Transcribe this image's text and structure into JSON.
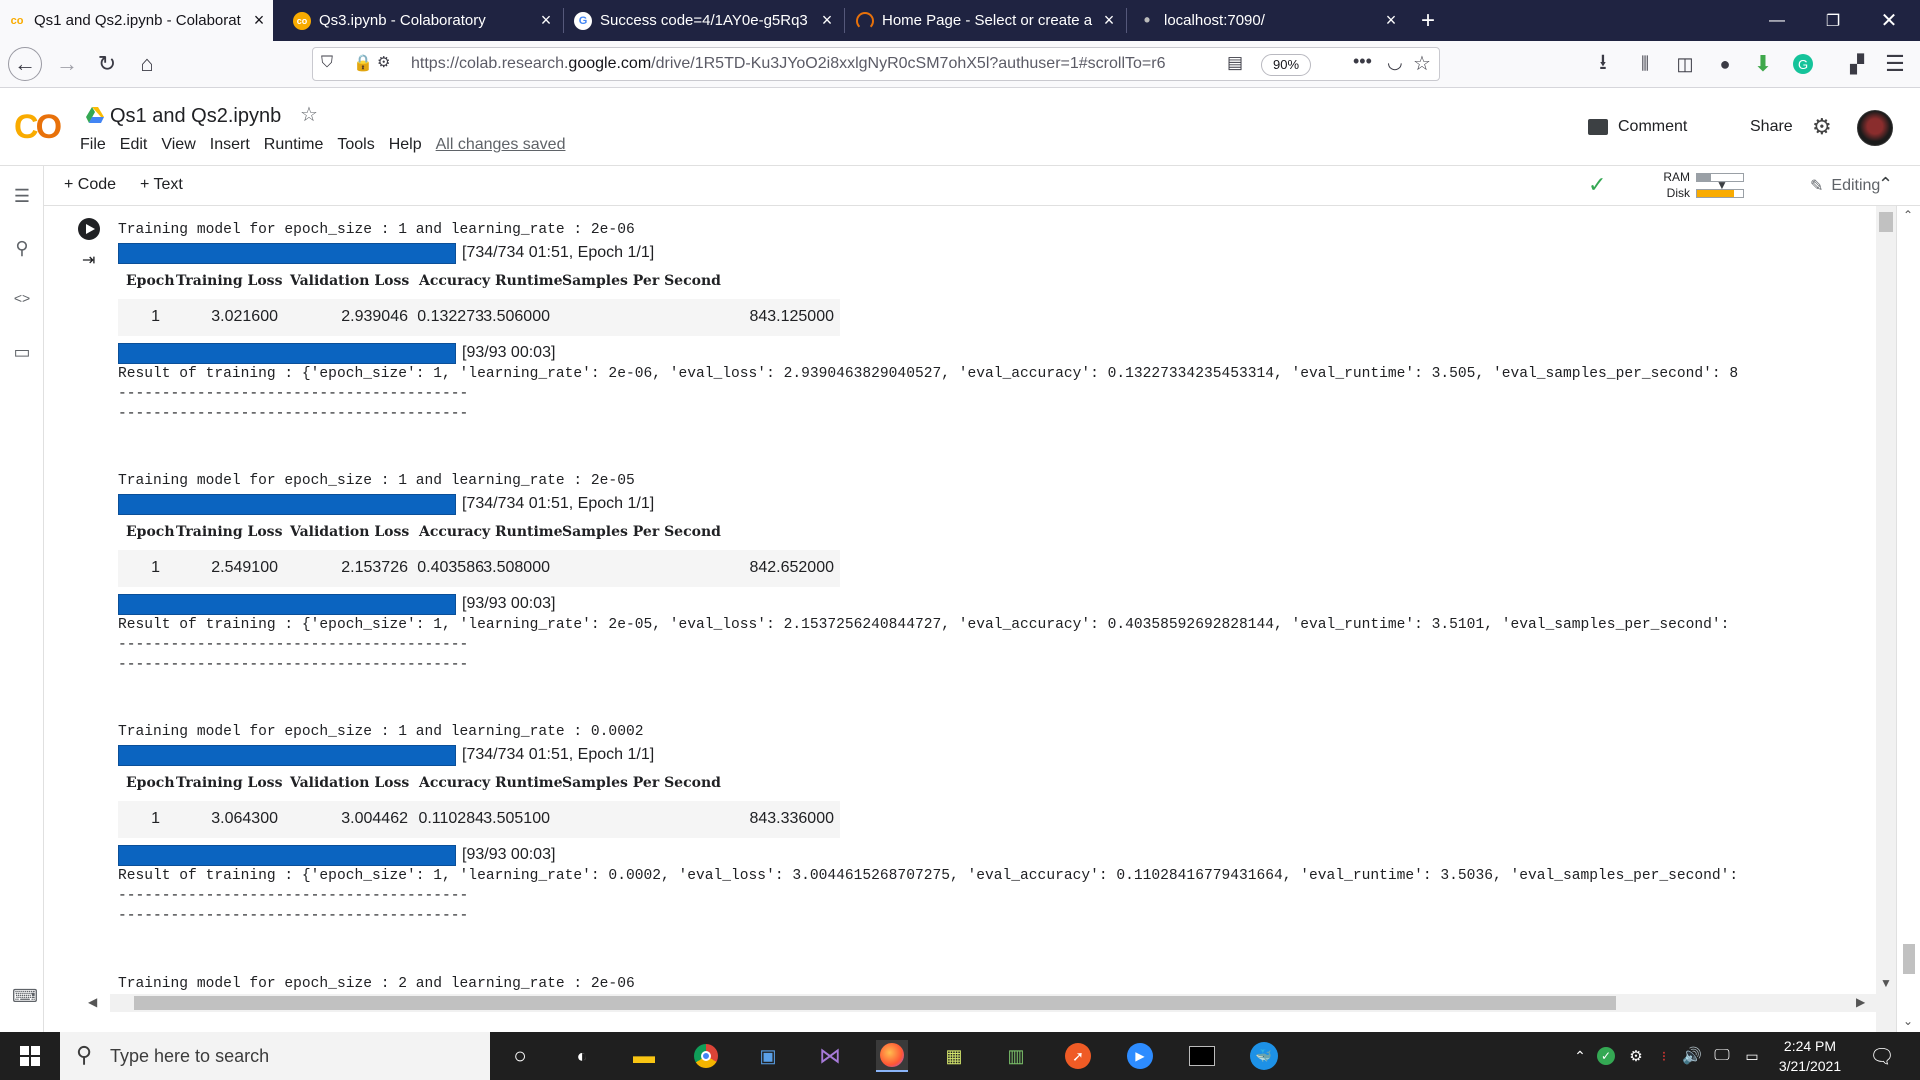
{
  "browser": {
    "tabs": [
      {
        "title": "Qs1 and Qs2.ipynb - Colaborat",
        "active": true,
        "favicon": "colab-icon"
      },
      {
        "title": "Qs3.ipynb - Colaboratory",
        "active": false,
        "favicon": "colab-icon"
      },
      {
        "title": "Success code=4/1AY0e-g5Rq3",
        "active": false,
        "favicon": "google-icon"
      },
      {
        "title": "Home Page - Select or create a",
        "active": false,
        "favicon": "loading-icon"
      },
      {
        "title": "localhost:7090/",
        "active": false,
        "favicon": "dot-icon"
      }
    ],
    "url_prefix": "https://colab.research.",
    "url_domain": "google.com",
    "url_suffix": "/drive/1R5TD-Ku3JYoO2i8xxlgNyR0cSM7ohX5l?authuser=1#scrollTo=r6",
    "zoom": "90%"
  },
  "colab": {
    "logo": "CO",
    "notebook_title": "Qs1 and Qs2.ipynb",
    "menu": [
      "File",
      "Edit",
      "View",
      "Insert",
      "Runtime",
      "Tools",
      "Help"
    ],
    "saved_status": "All changes saved",
    "comment_label": "Comment",
    "share_label": "Share",
    "toolbar": {
      "add_code": "+ Code",
      "add_text": "+ Text",
      "ram_label": "RAM",
      "disk_label": "Disk",
      "ram_fill": 0.3,
      "disk_fill": 0.8,
      "editing_label": "Editing"
    }
  },
  "output": {
    "blocks": [
      {
        "header": "Training model for epoch_size : 1 and learning_rate : 2e-06",
        "progress_train": "[734/734 01:51, Epoch 1/1]",
        "columns": [
          "Epoch",
          "Training Loss",
          "Validation Loss",
          "Accuracy",
          "Runtime",
          "Samples Per Second"
        ],
        "row": [
          "1",
          "3.021600",
          "2.939046",
          "0.132273",
          "3.506000",
          "843.125000"
        ],
        "progress_eval": "[93/93 00:03]",
        "result": "Result of training : {'epoch_size': 1, 'learning_rate': 2e-06, 'eval_loss': 2.9390463829040527, 'eval_accuracy': 0.13227334235453314, 'eval_runtime': 3.505, 'eval_samples_per_second': 8",
        "separator": "----------------------------------------"
      },
      {
        "header": "Training model for epoch_size : 1 and learning_rate : 2e-05",
        "progress_train": "[734/734 01:51, Epoch 1/1]",
        "columns": [
          "Epoch",
          "Training Loss",
          "Validation Loss",
          "Accuracy",
          "Runtime",
          "Samples Per Second"
        ],
        "row": [
          "1",
          "2.549100",
          "2.153726",
          "0.403586",
          "3.508000",
          "842.652000"
        ],
        "progress_eval": "[93/93 00:03]",
        "result": "Result of training : {'epoch_size': 1, 'learning_rate': 2e-05, 'eval_loss': 2.1537256240844727, 'eval_accuracy': 0.40358592692828144, 'eval_runtime': 3.5101, 'eval_samples_per_second':",
        "separator": "----------------------------------------"
      },
      {
        "header": "Training model for epoch_size : 1 and learning_rate : 0.0002",
        "progress_train": "[734/734 01:51, Epoch 1/1]",
        "columns": [
          "Epoch",
          "Training Loss",
          "Validation Loss",
          "Accuracy",
          "Runtime",
          "Samples Per Second"
        ],
        "row": [
          "1",
          "3.064300",
          "3.004462",
          "0.110284",
          "3.505100",
          "843.336000"
        ],
        "progress_eval": "[93/93 00:03]",
        "result": "Result of training : {'epoch_size': 1, 'learning_rate': 0.0002, 'eval_loss': 3.0044615268707275, 'eval_accuracy': 0.11028416779431664, 'eval_runtime': 3.5036, 'eval_samples_per_second':",
        "separator": "----------------------------------------"
      }
    ],
    "last_header": "Training model for epoch_size : 2 and learning_rate : 2e-06"
  },
  "taskbar": {
    "search_placeholder": "Type here to search",
    "time": "2:24 PM",
    "date": "3/21/2021"
  }
}
